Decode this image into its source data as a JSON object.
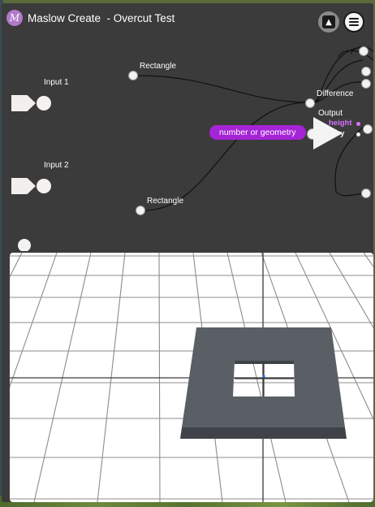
{
  "app": {
    "logo_glyph": "M",
    "title": "Maslow Create  - Overcut Test"
  },
  "toolbar": {
    "up_icon": "▲",
    "menu_icon": "hamburger-menu"
  },
  "nodes": {
    "input1": "Input 1",
    "input2": "Input 2",
    "rect_top": "Rectangle",
    "rect_bottom": "Rectangle",
    "difference": "Difference",
    "output": "Output",
    "output_height": "height",
    "output_geometry": "etry"
  },
  "tooltip": {
    "text": "number or geometry",
    "color": "#a524d6"
  },
  "colors": {
    "canvas": "#3b3b3b",
    "port": "#f2f2f2",
    "model": "#5a5f66",
    "grid": "#888888",
    "accent": "#a524d6"
  }
}
